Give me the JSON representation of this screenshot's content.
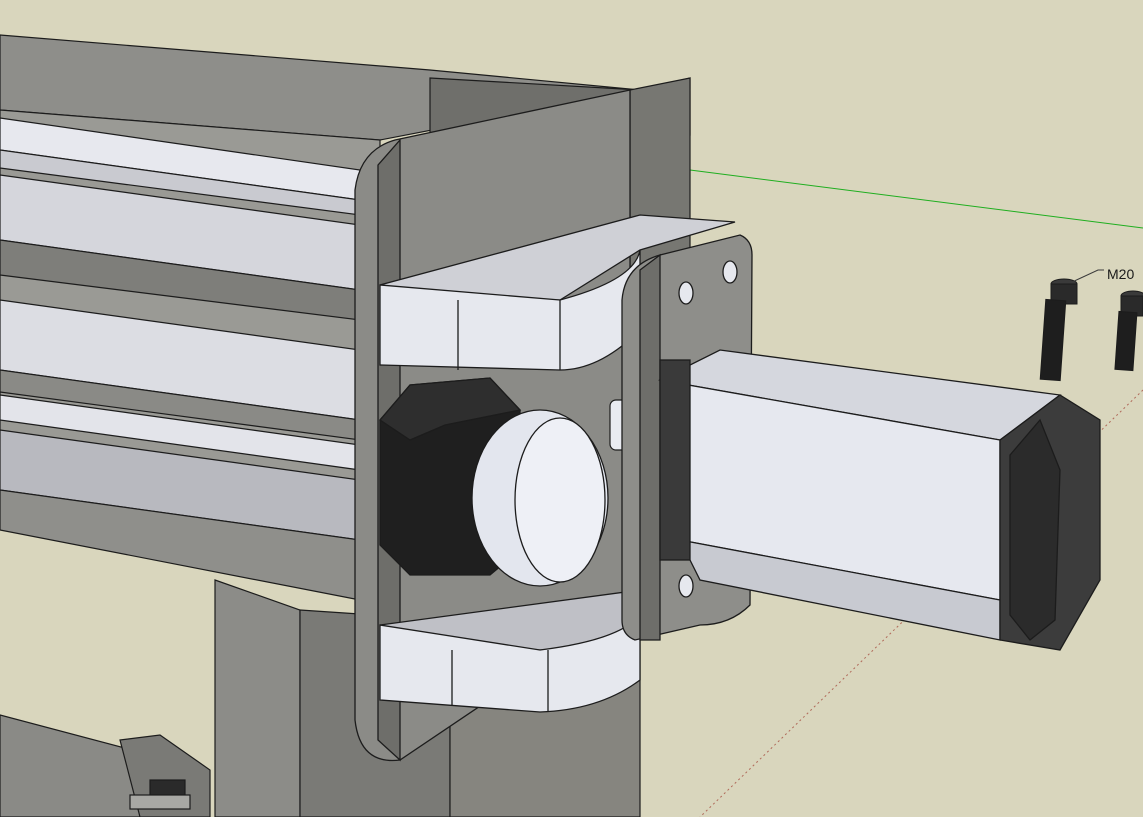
{
  "viewport": {
    "background": "#d9d6bd",
    "axis_colors": {
      "green": "#1fae1f",
      "red": "#b06a5a"
    }
  },
  "annotations": {
    "bolt_label": "M20"
  },
  "materials": {
    "steel": "#8a8a86",
    "steel_dark": "#5e5e5a",
    "aluminum": "#e4e6ec",
    "motor_body": "#e6e8ef",
    "motor_cap": "#3c3c3c",
    "bearing": "#1c1c1c",
    "bolt": "#1e1e1e",
    "edge": "#1c1c1c"
  }
}
